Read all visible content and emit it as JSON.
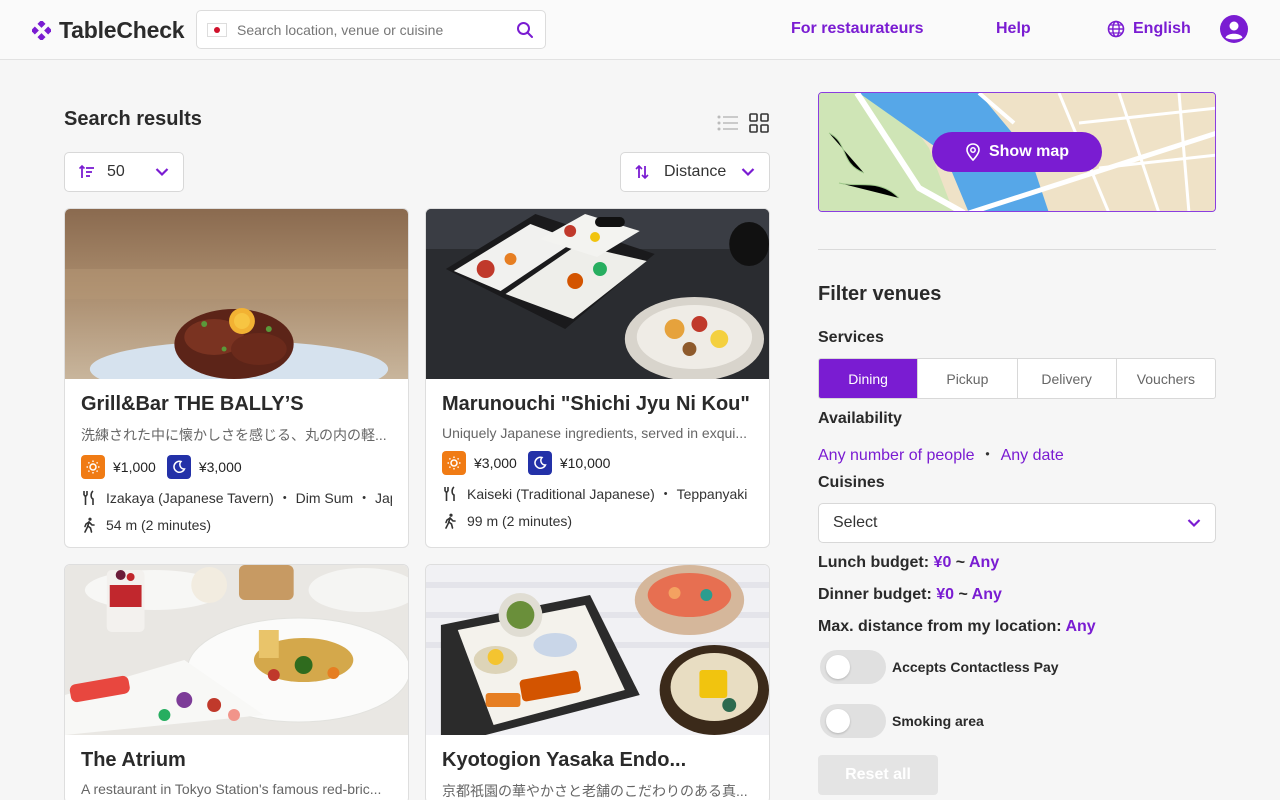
{
  "header": {
    "brand": "TableCheck",
    "search_placeholder": "Search location, venue or cuisine",
    "for_restaurateurs": "For restaurateurs",
    "help": "Help",
    "language": "English"
  },
  "results": {
    "title": "Search results",
    "per_page": "50",
    "sort": "Distance"
  },
  "cards": [
    {
      "title": "Grill&Bar THE BALLY’S",
      "description": "洗練された中に懐かしさを感じる、丸の内の軽...",
      "lunch_price": "¥1,000",
      "dinner_price": "¥3,000",
      "cuisines": "Izakaya (Japanese Tavern) ・ Dim Sum ・ Japanese",
      "distance": "54 m (2 minutes)"
    },
    {
      "title": "Marunouchi \"Shichi Jyu Ni Kou\"",
      "description": "Uniquely Japanese ingredients, served in exqui...",
      "lunch_price": "¥3,000",
      "dinner_price": "¥10,000",
      "cuisines": "Kaiseki (Traditional Japanese) ・ Teppanyaki",
      "distance": "99 m (2 minutes)"
    },
    {
      "title": "The Atrium",
      "description": "A restaurant in Tokyo Station's famous red-bric..."
    },
    {
      "title": "Kyotogion Yasaka Endo...",
      "description": "京都祇園の華やかさと老舗のこだわりのある真..."
    }
  ],
  "sidebar": {
    "show_map": "Show map",
    "filter_title": "Filter venues",
    "services_label": "Services",
    "services": [
      "Dining",
      "Pickup",
      "Delivery",
      "Vouchers"
    ],
    "services_active": "Dining",
    "availability_label": "Availability",
    "availability_people": "Any number of people",
    "availability_date": "Any date",
    "cuisines_label": "Cuisines",
    "cuisines_select": "Select",
    "lunch_budget_label": "Lunch budget:",
    "lunch_budget_min": "¥0",
    "lunch_budget_max": "Any",
    "dinner_budget_label": "Dinner budget:",
    "dinner_budget_min": "¥0",
    "dinner_budget_max": "Any",
    "distance_label": "Max. distance from my location:",
    "distance_value": "Any",
    "contactless_label": "Accepts Contactless Pay",
    "smoking_label": "Smoking area",
    "reset": "Reset all"
  },
  "colors": {
    "brand_purple": "#7a1cd2",
    "lunch_badge": "#f07b14",
    "dinner_badge": "#2331a8"
  }
}
